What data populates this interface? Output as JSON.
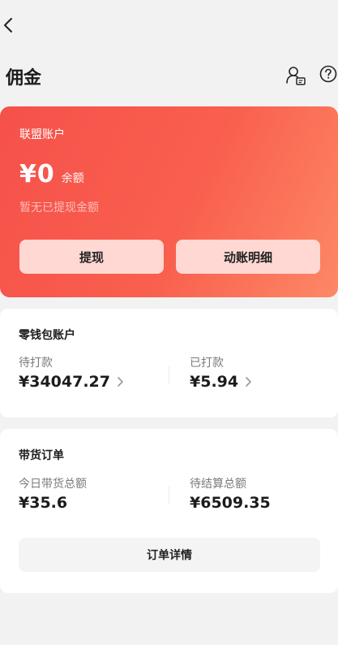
{
  "page": {
    "title": "佣金"
  },
  "icons": {
    "back": "chevron-left-icon",
    "user_card": "user-card-icon",
    "help": "question-circle-icon",
    "arrow": "chevron-right-icon"
  },
  "alliance": {
    "title": "联盟账户",
    "balance": "¥0",
    "balance_label": "余额",
    "note": "暂无已提现金额",
    "withdraw_label": "提现",
    "detail_label": "动账明细"
  },
  "wallet": {
    "title": "零钱包账户",
    "pending_label": "待打款",
    "pending_value": "¥34047.27",
    "paid_label": "已打款",
    "paid_value": "¥5.94"
  },
  "orders": {
    "title": "带货订单",
    "today_label": "今日带货总额",
    "today_value": "¥35.6",
    "settle_label": "待结算总额",
    "settle_value": "¥6509.35",
    "detail_button": "订单详情"
  },
  "colors": {
    "card_start": "#f6514a",
    "card_end": "#fd8866",
    "card_button": "#ffd8d3",
    "background": "#f2f2f2"
  }
}
